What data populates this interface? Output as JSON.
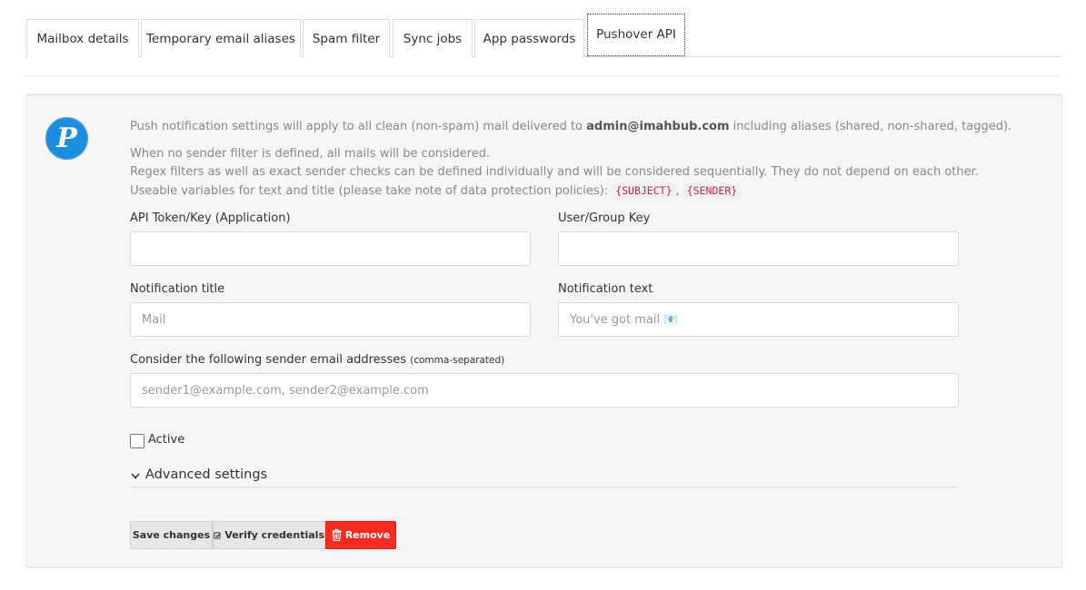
{
  "tabs": [
    {
      "label": "Mailbox details"
    },
    {
      "label": "Temporary email aliases"
    },
    {
      "label": "Spam filter"
    },
    {
      "label": "Sync jobs"
    },
    {
      "label": "App passwords"
    },
    {
      "label": "Pushover API",
      "active": true
    }
  ],
  "logo": {
    "letter": "P",
    "icon": "pushover-logo-icon",
    "color": "#1a8ee3"
  },
  "info": {
    "line1_prefix": "Push notification settings will apply to all clean (non-spam) mail delivered to",
    "line1_email": "admin@imahbub.com",
    "line1_suffix": "including aliases (shared, non-shared, tagged).",
    "line2": "When no sender filter is defined, all mails will be considered.",
    "line3": "Regex filters as well as exact sender checks can be defined individually and will be considered sequentially. They do not depend on each other.",
    "line4_prefix": "Useable variables for text and title (please take note of data protection policies):",
    "var_subject": "{SUBJECT}",
    "var_sep": ",",
    "var_sender": "{SENDER}"
  },
  "form": {
    "api_token_label": "API Token/Key (Application)",
    "api_token_value": "",
    "user_key_label": "User/Group Key",
    "user_key_value": "",
    "title_label": "Notification title",
    "title_placeholder": "Mail",
    "text_label": "Notification text",
    "text_placeholder": "You've got mail 📧",
    "senders_label": "Consider the following sender email addresses",
    "senders_hint": "(comma-separated)",
    "senders_placeholder": "sender1@example.com, sender2@example.com",
    "active_label": "Active",
    "active_checked": false,
    "advanced_label": "Advanced settings"
  },
  "buttons": {
    "save": "Save changes",
    "verify": "Verify credentials",
    "remove": "Remove"
  },
  "colors": {
    "remove_bg": "#ff2a20",
    "code_text": "#c7254e"
  }
}
